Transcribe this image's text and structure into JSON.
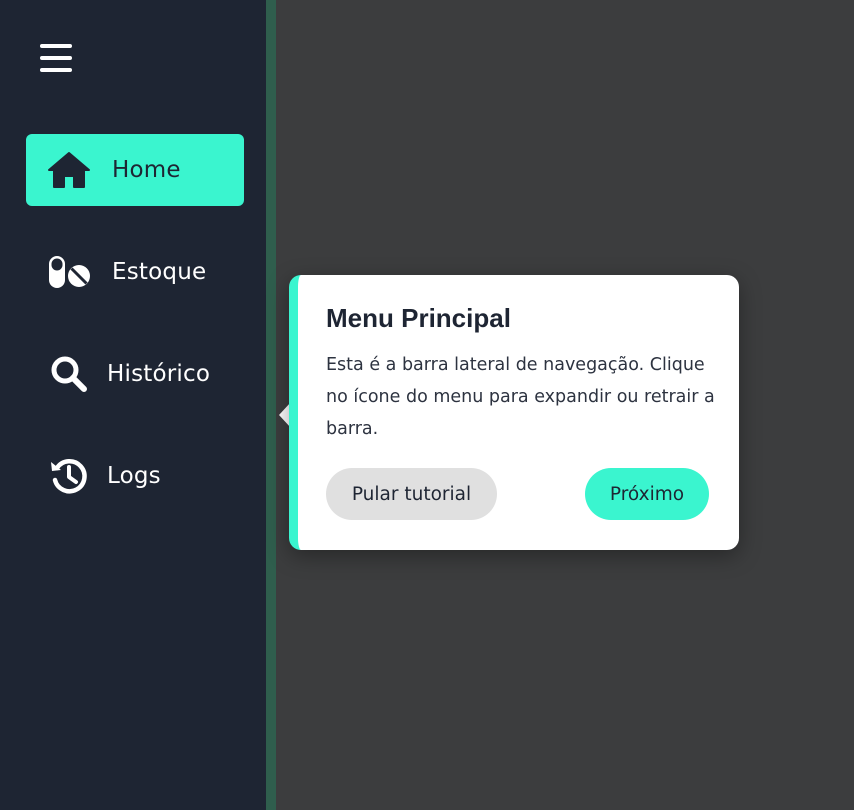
{
  "sidebar": {
    "items": [
      {
        "label": "Home",
        "icon": "home-icon",
        "active": true
      },
      {
        "label": "Estoque",
        "icon": "pills-icon",
        "active": false
      },
      {
        "label": "Histórico",
        "icon": "search-icon",
        "active": false
      },
      {
        "label": "Logs",
        "icon": "history-icon",
        "active": false
      }
    ]
  },
  "tooltip": {
    "title": "Menu Principal",
    "text": "Esta é a barra lateral de navegação. Clique no ícone do menu para expandir ou retrair a barra.",
    "skip_label": "Pular tutorial",
    "next_label": "Próximo"
  },
  "colors": {
    "sidebar_bg": "#1e2533",
    "accent": "#3af5cf",
    "overlay": "#3c3d3e",
    "sidebar_edge": "#2f5e4d"
  }
}
